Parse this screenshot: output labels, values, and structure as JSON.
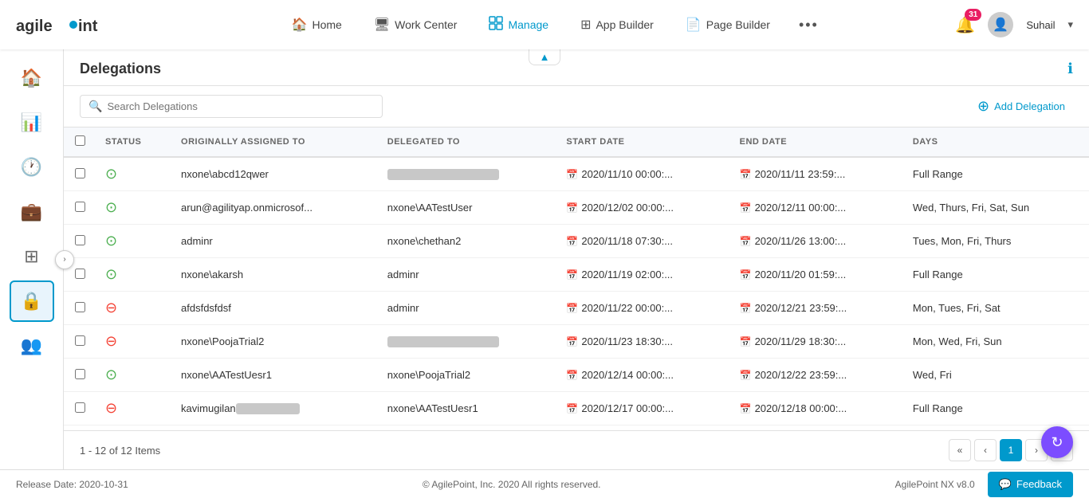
{
  "nav": {
    "logo": "agilepoint",
    "items": [
      {
        "id": "home",
        "label": "Home",
        "icon": "🏠"
      },
      {
        "id": "workcenter",
        "label": "Work Center",
        "icon": "🖥"
      },
      {
        "id": "manage",
        "label": "Manage",
        "icon": "📋",
        "active": true
      },
      {
        "id": "appbuilder",
        "label": "App Builder",
        "icon": "⊞"
      },
      {
        "id": "pagebuilder",
        "label": "Page Builder",
        "icon": "📄"
      }
    ],
    "more_icon": "•••",
    "notification_count": "31",
    "user_name": "Suhail"
  },
  "sidebar": {
    "items": [
      {
        "id": "home",
        "icon": "🏠"
      },
      {
        "id": "chart",
        "icon": "📊"
      },
      {
        "id": "clock",
        "icon": "🕐"
      },
      {
        "id": "briefcase",
        "icon": "💼"
      },
      {
        "id": "grid",
        "icon": "⊞"
      },
      {
        "id": "lock",
        "icon": "🔒",
        "active": true
      },
      {
        "id": "users",
        "icon": "👥"
      }
    ]
  },
  "panel": {
    "title": "Delegations",
    "add_button": "Add Delegation",
    "search_placeholder": "Search Delegations"
  },
  "table": {
    "columns": [
      "",
      "STATUS",
      "ORIGINALLY ASSIGNED TO",
      "DELEGATED TO",
      "START DATE",
      "END DATE",
      "DAYS"
    ],
    "rows": [
      {
        "status": "active",
        "originally_assigned": "nxone\\abcd12qwer",
        "delegated_to": "BLURRED",
        "start_date": "2020/11/10 00:00:...",
        "end_date": "2020/11/11 23:59:...",
        "days": "Full Range"
      },
      {
        "status": "active",
        "originally_assigned": "arun@agilityap.onmicrosof...",
        "delegated_to": "nxone\\AATestUser",
        "start_date": "2020/12/02 00:00:...",
        "end_date": "2020/12/11 00:00:...",
        "days": "Wed, Thurs, Fri, Sat, Sun"
      },
      {
        "status": "active",
        "originally_assigned": "adminr",
        "delegated_to": "nxone\\chethan2",
        "start_date": "2020/11/18 07:30:...",
        "end_date": "2020/11/26 13:00:...",
        "days": "Tues, Mon, Fri, Thurs"
      },
      {
        "status": "active",
        "originally_assigned": "nxone\\akarsh",
        "delegated_to": "adminr",
        "start_date": "2020/11/19 02:00:...",
        "end_date": "2020/11/20 01:59:...",
        "days": "Full Range"
      },
      {
        "status": "inactive",
        "originally_assigned": "afdsfdsfdsf",
        "delegated_to": "adminr",
        "start_date": "2020/11/22 00:00:...",
        "end_date": "2020/12/21 23:59:...",
        "days": "Mon, Tues, Fri, Sat"
      },
      {
        "status": "inactive",
        "originally_assigned": "nxone\\PoojaTrial2",
        "delegated_to": "BLURRED",
        "start_date": "2020/11/23 18:30:...",
        "end_date": "2020/11/29 18:30:...",
        "days": "Mon, Wed, Fri, Sun"
      },
      {
        "status": "active",
        "originally_assigned": "nxone\\AATestUesr1",
        "delegated_to": "nxone\\PoojaTrial2",
        "start_date": "2020/12/14 00:00:...",
        "end_date": "2020/12/22 23:59:...",
        "days": "Wed, Fri"
      },
      {
        "status": "inactive",
        "originally_assigned": "kavimugilanBLURRED",
        "delegated_to": "nxone\\AATestUesr1",
        "start_date": "2020/12/17 00:00:...",
        "end_date": "2020/12/18 00:00:...",
        "days": "Full Range"
      }
    ]
  },
  "pagination": {
    "info": "1 - 12 of 12 Items",
    "current_page": "1"
  },
  "footer": {
    "release_date": "Release Date: 2020-10-31",
    "copyright": "© AgilePoint, Inc. 2020 All rights reserved.",
    "version": "AgilePoint NX v8.0",
    "feedback": "Feedback"
  }
}
